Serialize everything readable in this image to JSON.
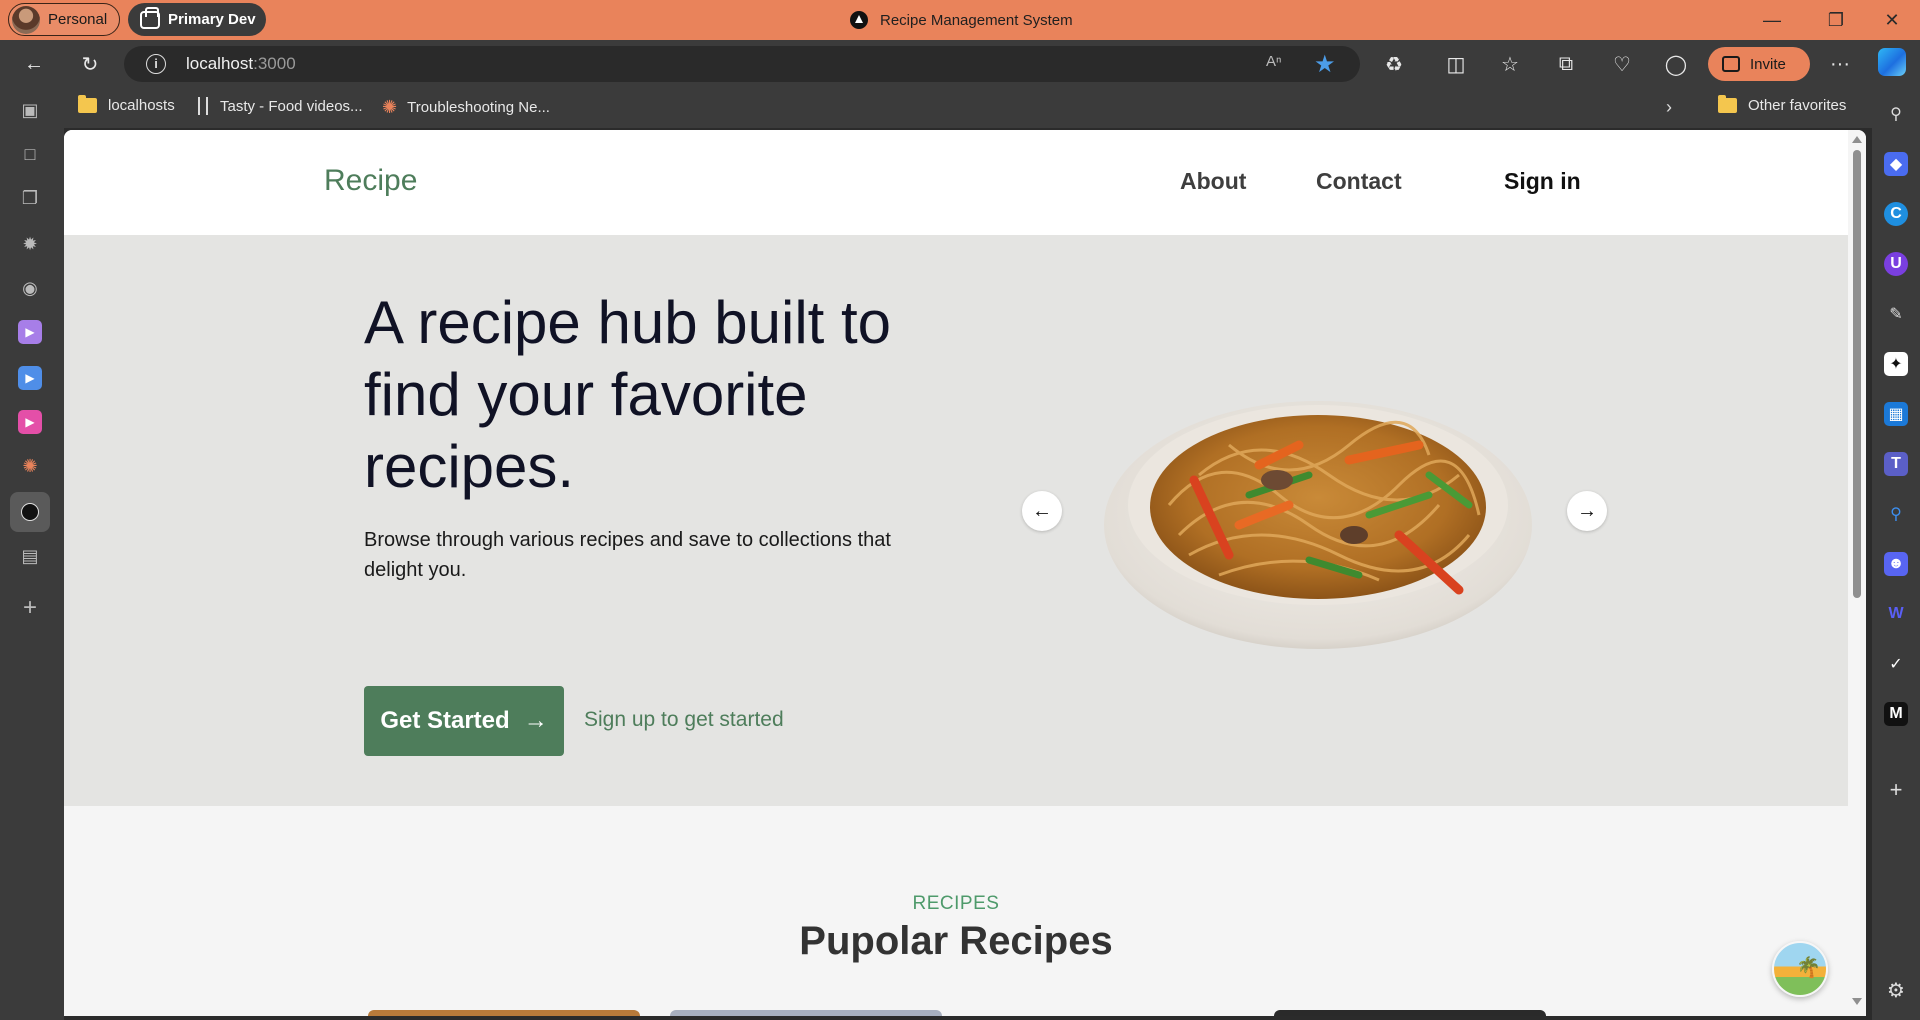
{
  "browser": {
    "profile_personal": "Personal",
    "profile_workspace": "Primary Dev",
    "tab_title": "Recipe Management System",
    "url_host": "localhost",
    "url_port": ":3000",
    "read_aloud": "A̅",
    "invite_label": "Invite",
    "more_label": "···",
    "accent_color": "#e9835b"
  },
  "favorites": {
    "items": [
      {
        "label": "localhosts",
        "icon": "folder-icon"
      },
      {
        "label": "Tasty - Food videos...",
        "icon": "fork-icon"
      },
      {
        "label": "Troubleshooting Ne...",
        "icon": "spark-icon"
      }
    ],
    "other": "Other favorites"
  },
  "site": {
    "logo": "Recipe",
    "nav": {
      "about": "About",
      "contact": "Contact",
      "signin": "Sign in"
    },
    "brand_color": "#4e7d5b"
  },
  "hero": {
    "title": "A recipe hub built to find your favorite recipes.",
    "subtitle": "Browse through various recipes and save to collections that delight you.",
    "cta_label": "Get Started",
    "cta_link": "Sign up to get started",
    "prev_icon": "arrow-left-icon",
    "next_icon": "arrow-right-icon"
  },
  "recipes_section": {
    "eyebrow": "RECIPES",
    "title": "Pupolar Recipes"
  }
}
